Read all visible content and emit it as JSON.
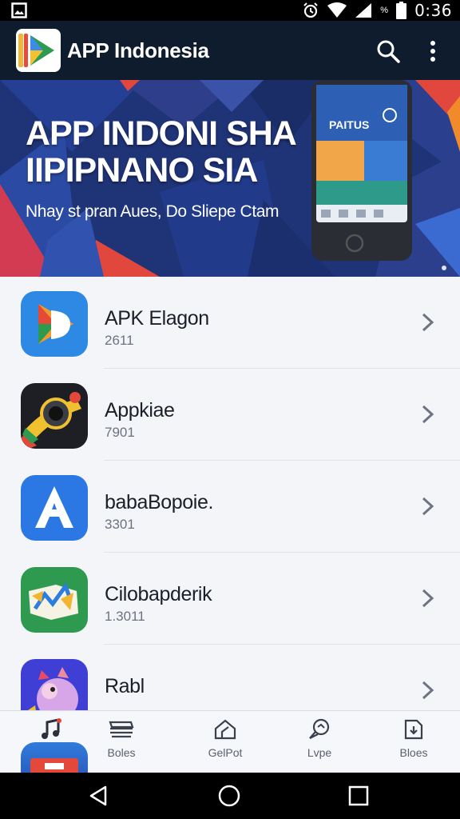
{
  "status_bar": {
    "time": "0:36",
    "battery_pct": "%",
    "icons": [
      "image-icon",
      "alarm-icon",
      "wifi-icon",
      "signal-icon",
      "battery-icon"
    ]
  },
  "app_bar": {
    "title": "APP Indonesia",
    "icons": [
      "app-logo",
      "search-icon",
      "more-vert-icon"
    ],
    "background": "#0f1c2e"
  },
  "banner": {
    "headline_line1": "APP INDONI SHA",
    "headline_line2": "IIPIPNANO SIA",
    "subtitle": "Nhay st pran Aues, Do Sliepe Ctam",
    "phone_label": "PAITUS"
  },
  "apps": [
    {
      "name": "APK Elagon",
      "count": "2611",
      "icon": "play-icon"
    },
    {
      "name": "Appkiae",
      "count": "7901",
      "icon": "camera-icon"
    },
    {
      "name": "babaBopoie.",
      "count": "3301",
      "icon": "letter-a-icon"
    },
    {
      "name": "Cilobapderik",
      "count": "1.3011",
      "icon": "chart-icon"
    },
    {
      "name": "Rabl",
      "count": "",
      "icon": "mascot-icon"
    }
  ],
  "bottom_nav": [
    {
      "label": "",
      "icon": "music-icon"
    },
    {
      "label": "Boles",
      "icon": "layers-icon"
    },
    {
      "label": "GelPot",
      "icon": "house-icon"
    },
    {
      "label": "Lvpe",
      "icon": "chat-icon"
    },
    {
      "label": "Bloes",
      "icon": "download-icon"
    }
  ],
  "system_nav": [
    "back-icon",
    "home-icon",
    "recents-icon"
  ],
  "colors": {
    "accent": "#2e7de0",
    "list_bg": "#f3f5f9"
  }
}
